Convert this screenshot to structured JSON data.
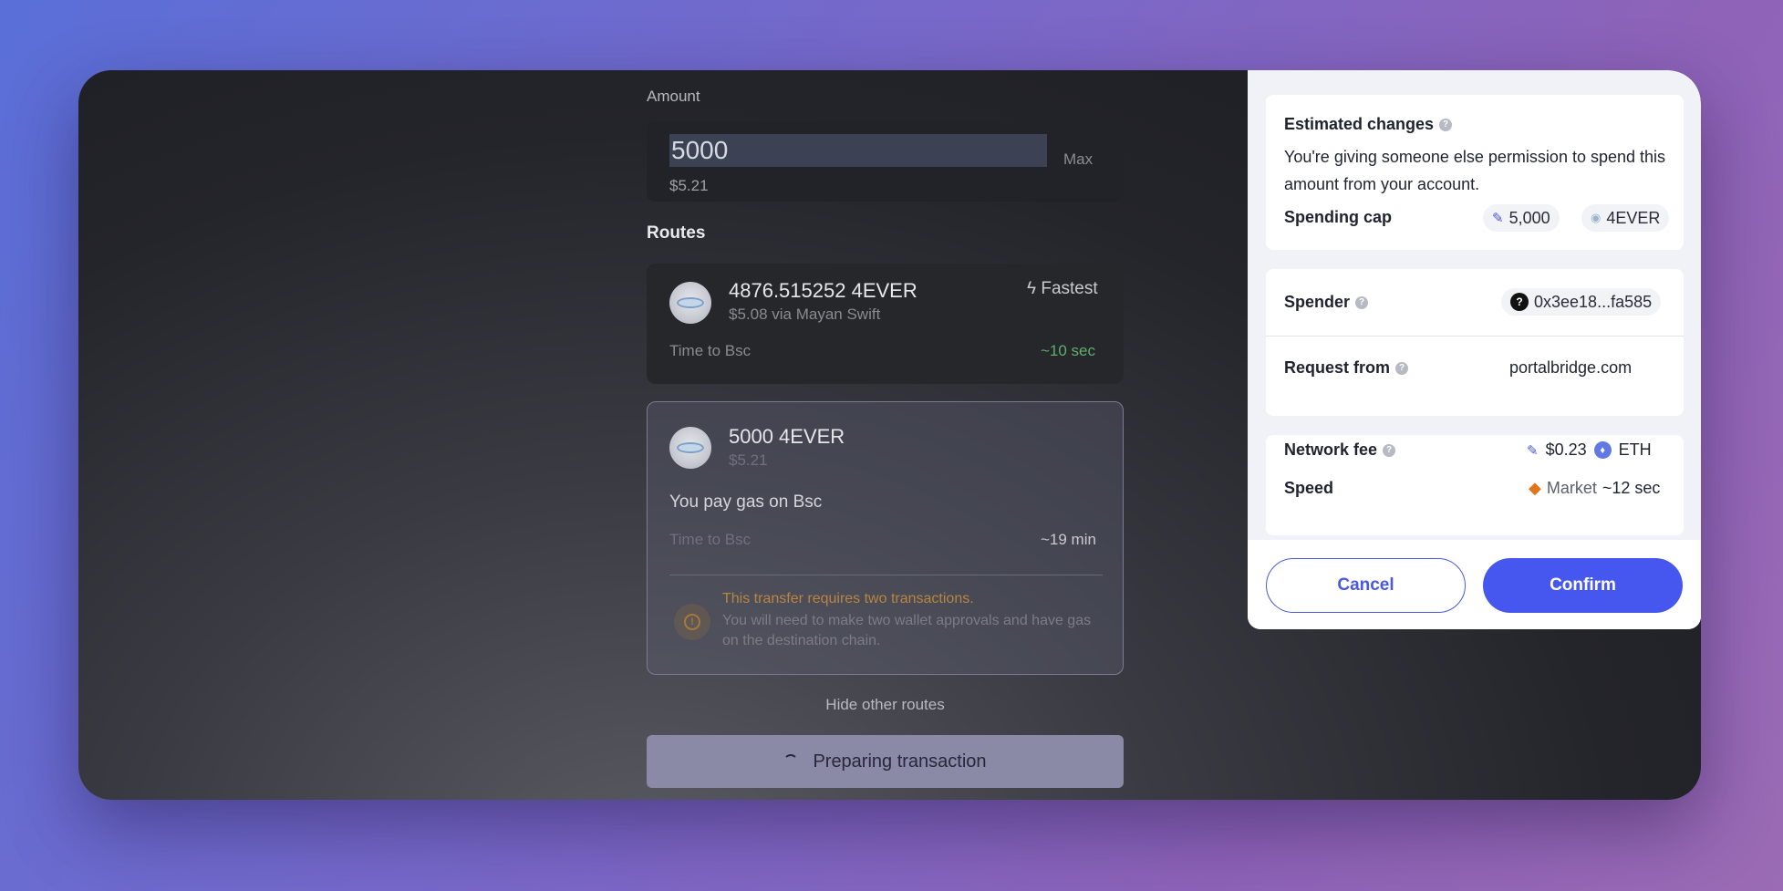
{
  "bridge": {
    "amount_label": "Amount",
    "amount_value": "5000",
    "max_label": "Max",
    "amount_usd": "$5.21",
    "routes_label": "Routes",
    "route1": {
      "title": "4876.515252 4EVER",
      "subtitle": "$5.08 via Mayan Swift",
      "badge": "Fastest",
      "time_label": "Time to Bsc",
      "time_value": "~10 sec"
    },
    "route2": {
      "title": "5000 4EVER",
      "subtitle": "$5.21",
      "gas_note": "You pay gas on Bsc",
      "time_label": "Time to Bsc",
      "time_value": "~19 min",
      "warning_title": "This transfer requires two transactions.",
      "warning_body": "You will need to make two wallet approvals and have gas on the destination chain."
    },
    "hide_routes": "Hide other routes",
    "prepare_button": "Preparing transaction"
  },
  "wallet": {
    "estimated_changes_title": "Estimated changes",
    "estimated_changes_body": "You're giving someone else permission to spend this amount from your account.",
    "spending_cap_label": "Spending cap",
    "spending_cap_value": "5,000",
    "spending_cap_token": "4EVER",
    "spender_label": "Spender",
    "spender_address": "0x3ee18...fa585",
    "request_from_label": "Request from",
    "request_from_value": "portalbridge.com",
    "network_fee_label": "Network fee",
    "network_fee_value": "$0.23",
    "network_fee_token": "ETH",
    "speed_label": "Speed",
    "speed_mode": "Market",
    "speed_time": "~12 sec",
    "cancel_label": "Cancel",
    "confirm_label": "Confirm"
  },
  "colors": {
    "accent": "#4557ee",
    "warning": "#b98540",
    "success": "#5fae6e"
  }
}
